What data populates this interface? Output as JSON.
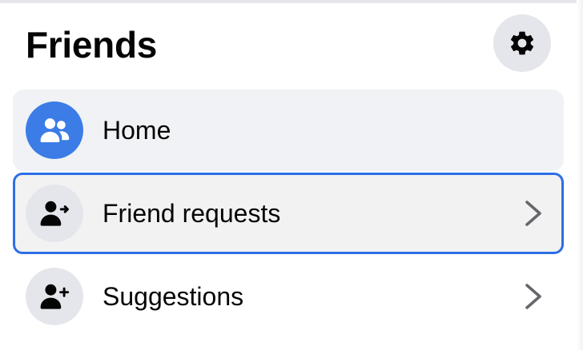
{
  "header": {
    "title": "Friends",
    "settings_icon": "gear-icon"
  },
  "nav": {
    "items": [
      {
        "label": "Home",
        "icon": "friends-group-icon",
        "selected": true
      },
      {
        "label": "Friend requests",
        "icon": "person-arrow-icon",
        "focused": true,
        "has_chevron": true
      },
      {
        "label": "Suggestions",
        "icon": "person-add-icon",
        "has_chevron": true
      }
    ]
  },
  "colors": {
    "accent": "#2d6ee6",
    "home_icon_bg": "#3b7ce6",
    "icon_bg": "#e4e6eb",
    "selected_bg": "#f0f2f5",
    "text": "#050505"
  }
}
